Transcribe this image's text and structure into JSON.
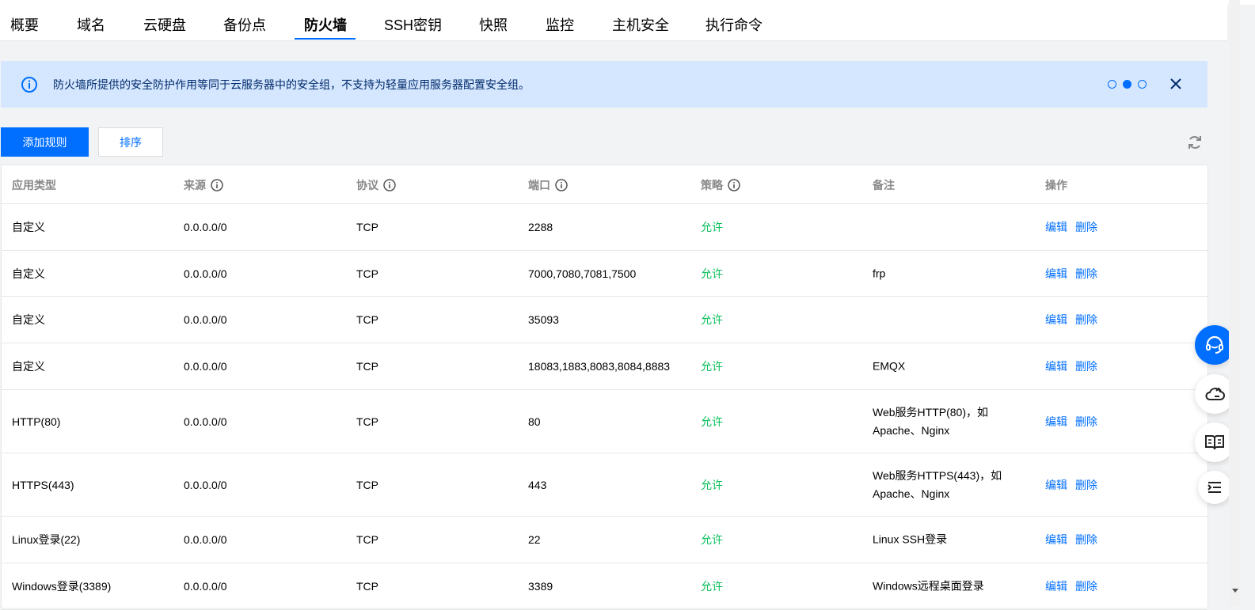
{
  "tabs": [
    {
      "label": "概要",
      "active": false
    },
    {
      "label": "域名",
      "active": false
    },
    {
      "label": "云硬盘",
      "active": false
    },
    {
      "label": "备份点",
      "active": false
    },
    {
      "label": "防火墙",
      "active": true
    },
    {
      "label": "SSH密钥",
      "active": false
    },
    {
      "label": "快照",
      "active": false
    },
    {
      "label": "监控",
      "active": false
    },
    {
      "label": "主机安全",
      "active": false
    },
    {
      "label": "执行命令",
      "active": false
    }
  ],
  "notice": {
    "text": "防火墙所提供的安全防护作用等同于云服务器中的安全组，不支持为轻量应用服务器配置安全组。",
    "active_dot": 2,
    "dot_count": 3
  },
  "toolbar": {
    "add_rule_label": "添加规则",
    "sort_label": "排序"
  },
  "table": {
    "headers": {
      "app_type": "应用类型",
      "source": "来源",
      "protocol": "协议",
      "port": "端口",
      "policy": "策略",
      "note": "备注",
      "ops": "操作"
    },
    "rows": [
      {
        "app_type": "自定义",
        "source": "0.0.0.0/0",
        "protocol": "TCP",
        "port": "2288",
        "policy": "允许",
        "note": "",
        "edit": "编辑",
        "delete": "删除"
      },
      {
        "app_type": "自定义",
        "source": "0.0.0.0/0",
        "protocol": "TCP",
        "port": "7000,7080,7081,7500",
        "policy": "允许",
        "note": "frp",
        "edit": "编辑",
        "delete": "删除"
      },
      {
        "app_type": "自定义",
        "source": "0.0.0.0/0",
        "protocol": "TCP",
        "port": "35093",
        "policy": "允许",
        "note": "",
        "edit": "编辑",
        "delete": "删除"
      },
      {
        "app_type": "自定义",
        "source": "0.0.0.0/0",
        "protocol": "TCP",
        "port": "18083,1883,8083,8084,8883",
        "policy": "允许",
        "note": "EMQX",
        "edit": "编辑",
        "delete": "删除"
      },
      {
        "app_type": "HTTP(80)",
        "source": "0.0.0.0/0",
        "protocol": "TCP",
        "port": "80",
        "policy": "允许",
        "note": "Web服务HTTP(80)，如Apache、Nginx",
        "edit": "编辑",
        "delete": "删除"
      },
      {
        "app_type": "HTTPS(443)",
        "source": "0.0.0.0/0",
        "protocol": "TCP",
        "port": "443",
        "policy": "允许",
        "note": "Web服务HTTPS(443)，如Apache、Nginx",
        "edit": "编辑",
        "delete": "删除"
      },
      {
        "app_type": "Linux登录(22)",
        "source": "0.0.0.0/0",
        "protocol": "TCP",
        "port": "22",
        "policy": "允许",
        "note": "Linux SSH登录",
        "edit": "编辑",
        "delete": "删除"
      },
      {
        "app_type": "Windows登录(3389)",
        "source": "0.0.0.0/0",
        "protocol": "TCP",
        "port": "3389",
        "policy": "允许",
        "note": "Windows远程桌面登录",
        "edit": "编辑",
        "delete": "删除"
      }
    ]
  },
  "float_buttons": [
    "headset-icon",
    "cloud-icon",
    "book-icon",
    "menu-indent-icon"
  ],
  "colors": {
    "accent": "#006eff",
    "allow": "#0abf5b",
    "notice_bg": "#d5e7ff"
  }
}
